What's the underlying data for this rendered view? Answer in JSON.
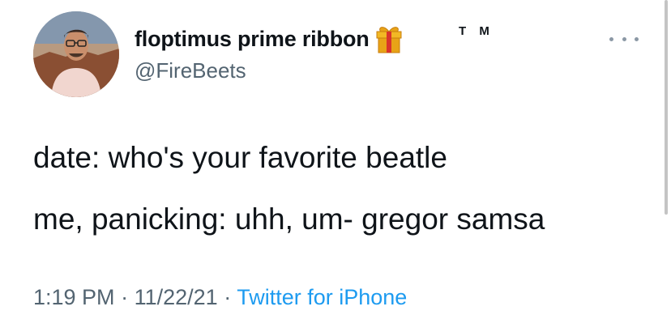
{
  "user": {
    "display_name": "floptimus prime ribbon",
    "emoji_icon": "gift-icon",
    "tm_mark": "T M",
    "handle": "@FireBeets"
  },
  "tweet": {
    "lines": [
      "date: who's your favorite beatle",
      "me, panicking: uhh, um- gregor samsa"
    ]
  },
  "meta": {
    "time": "1:19 PM",
    "separator": "·",
    "date": "11/22/21",
    "source": "Twitter for iPhone"
  },
  "colors": {
    "text": "#0f1419",
    "secondary": "#536471",
    "link": "#1d9bf0",
    "gift_box": "#e8a317",
    "gift_ribbon": "#d9342b"
  }
}
